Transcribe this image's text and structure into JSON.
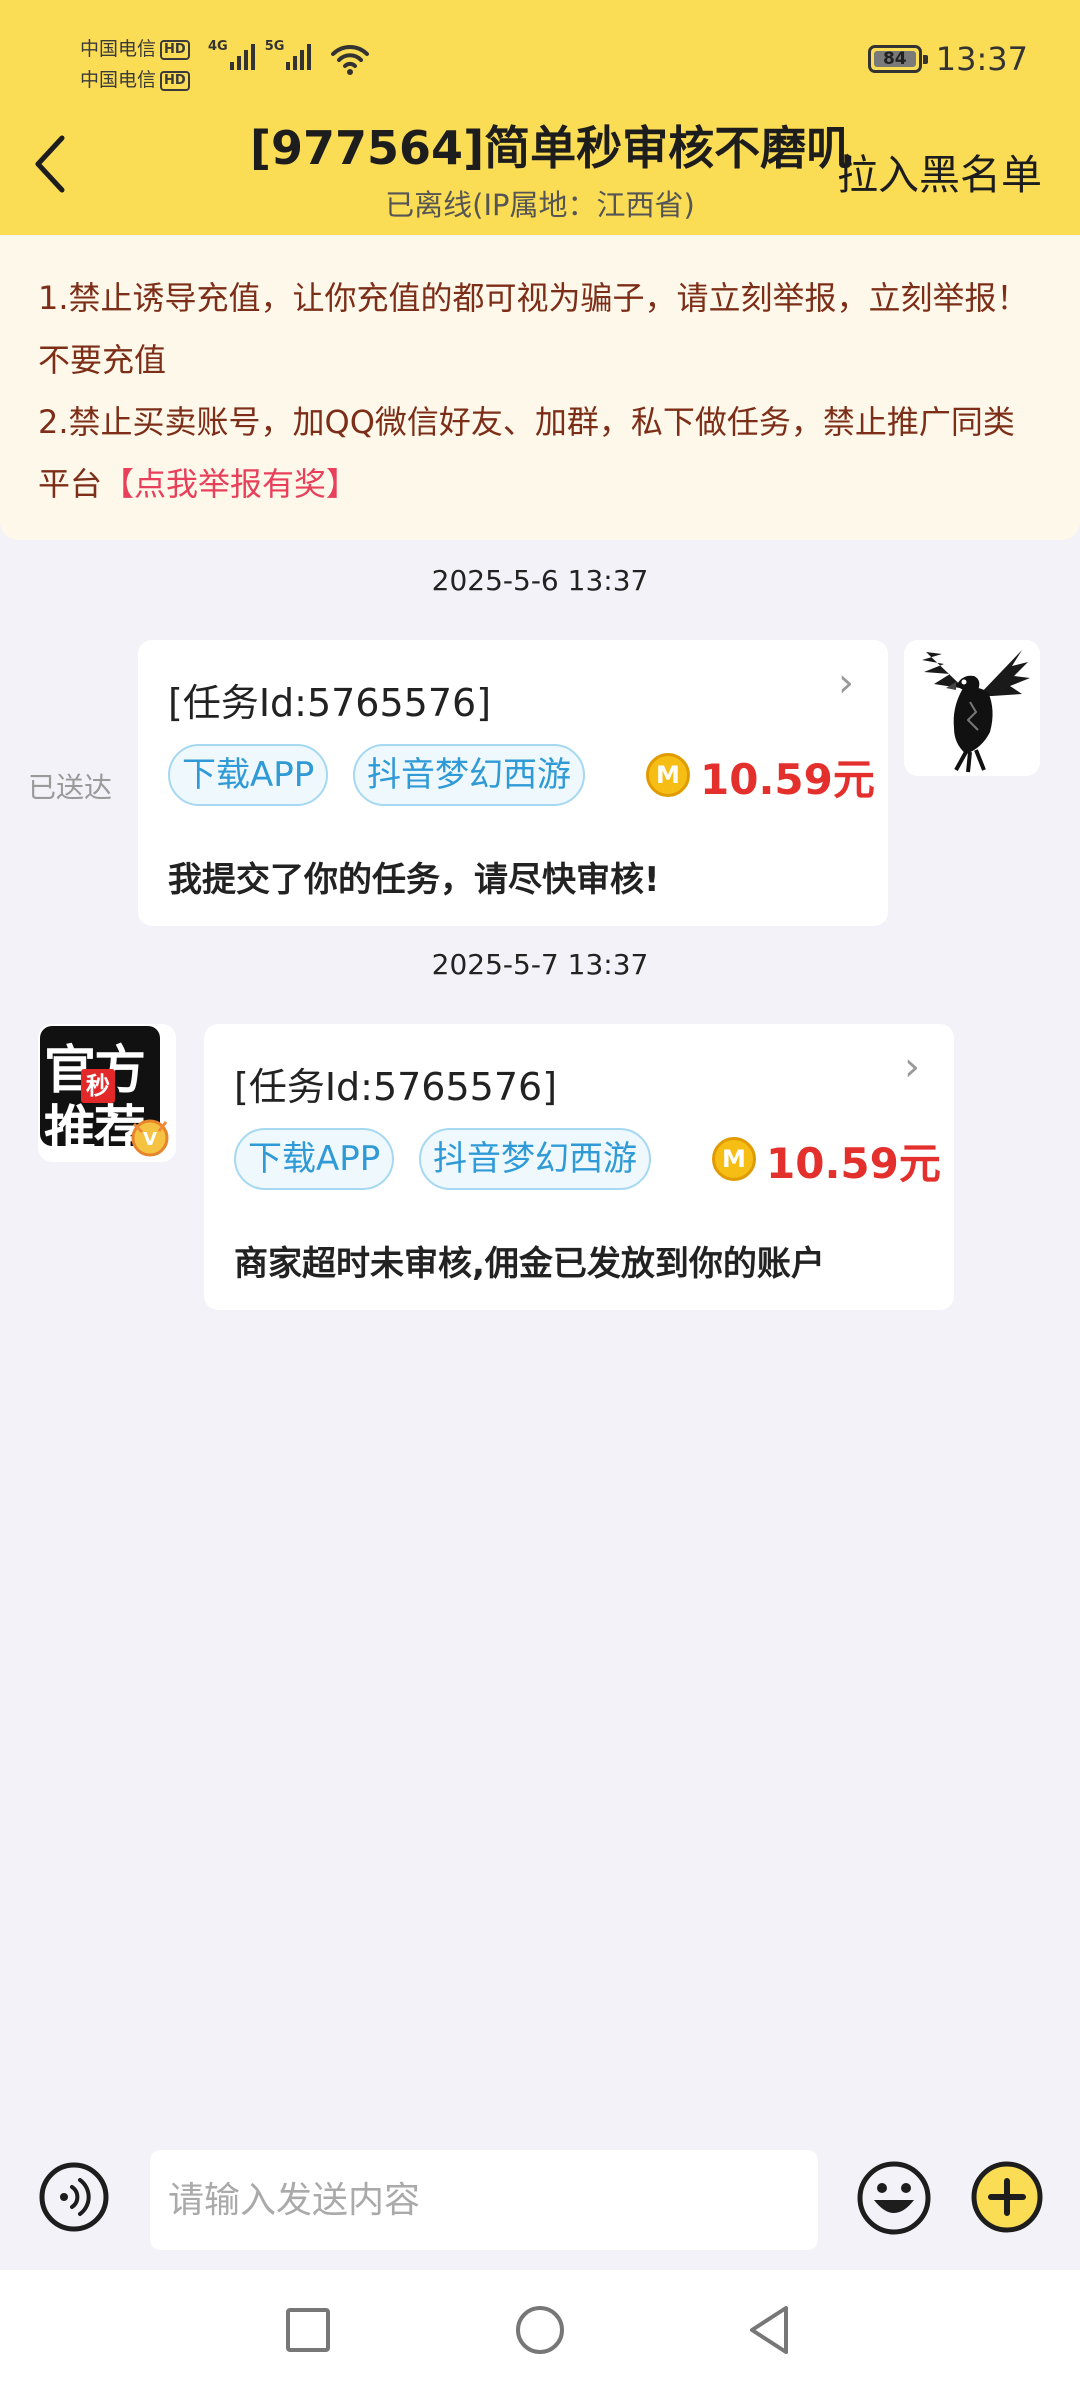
{
  "status_bar": {
    "carrier_1": "中国电信",
    "carrier_2": "中国电信",
    "hd_1": "HD",
    "hd_2": "HD",
    "net_1": "4G",
    "net_2": "5G",
    "battery": "84",
    "time": "13:37",
    "icons": [
      "signal-icon",
      "wifi-icon",
      "battery-icon"
    ]
  },
  "header": {
    "back_icon": "chevron-left-icon",
    "title": "[977564]简单秒审核不磨叽",
    "subtitle": "已离线(IP属地：江西省)",
    "blacklist_label": "拉入黑名单",
    "background_color": "#fadc55"
  },
  "notice": {
    "line1": "1.禁止诱导充值，让你充值的都可视为骗子，请立刻举报，立刻举报！不要充值",
    "line2": "2.禁止买卖账号，加QQ微信好友、加群，私下做任务，禁止推广同类平台",
    "report_link": "【点我举报有奖】",
    "text_color": "#7d2e18",
    "link_color": "#e8405b"
  },
  "chat": {
    "messages": [
      {
        "timestamp": "2025-5-6 13:37",
        "side": "right",
        "status": "已送达",
        "task_id": "[任务Id:5765576]",
        "tags": [
          "下载APP",
          "抖音梦幻西游"
        ],
        "coin_icon": "coin-icon",
        "coin_letter": "M",
        "reward": "10.59元",
        "text": "我提交了你的任务，请尽快审核!",
        "avatar": "eagle-avatar"
      },
      {
        "timestamp": "2025-5-7 13:37",
        "side": "left",
        "task_id": "[任务Id:5765576]",
        "tags": [
          "下载APP",
          "抖音梦幻西游"
        ],
        "coin_icon": "coin-icon",
        "coin_letter": "M",
        "reward": "10.59元",
        "text": "商家超时未审核,佣金已发放到你的账户",
        "avatar": "official-avatar",
        "avatar_text_top": "官方",
        "avatar_text_bottom": "推荐",
        "avatar_badge": "秒",
        "vip_badge": "V"
      }
    ]
  },
  "input_bar": {
    "placeholder": "请输入发送内容",
    "value": "",
    "voice_icon": "voice-icon",
    "emoji_icon": "emoji-icon",
    "plus_icon": "plus-icon"
  },
  "nav_bar": {
    "icons": [
      "recents-square-icon",
      "home-circle-icon",
      "back-triangle-icon"
    ]
  },
  "colors": {
    "accent_yellow": "#fadc55",
    "price_red": "#e3302c",
    "tag_blue": "#2f9ad6",
    "background": "#f2f2f8"
  }
}
